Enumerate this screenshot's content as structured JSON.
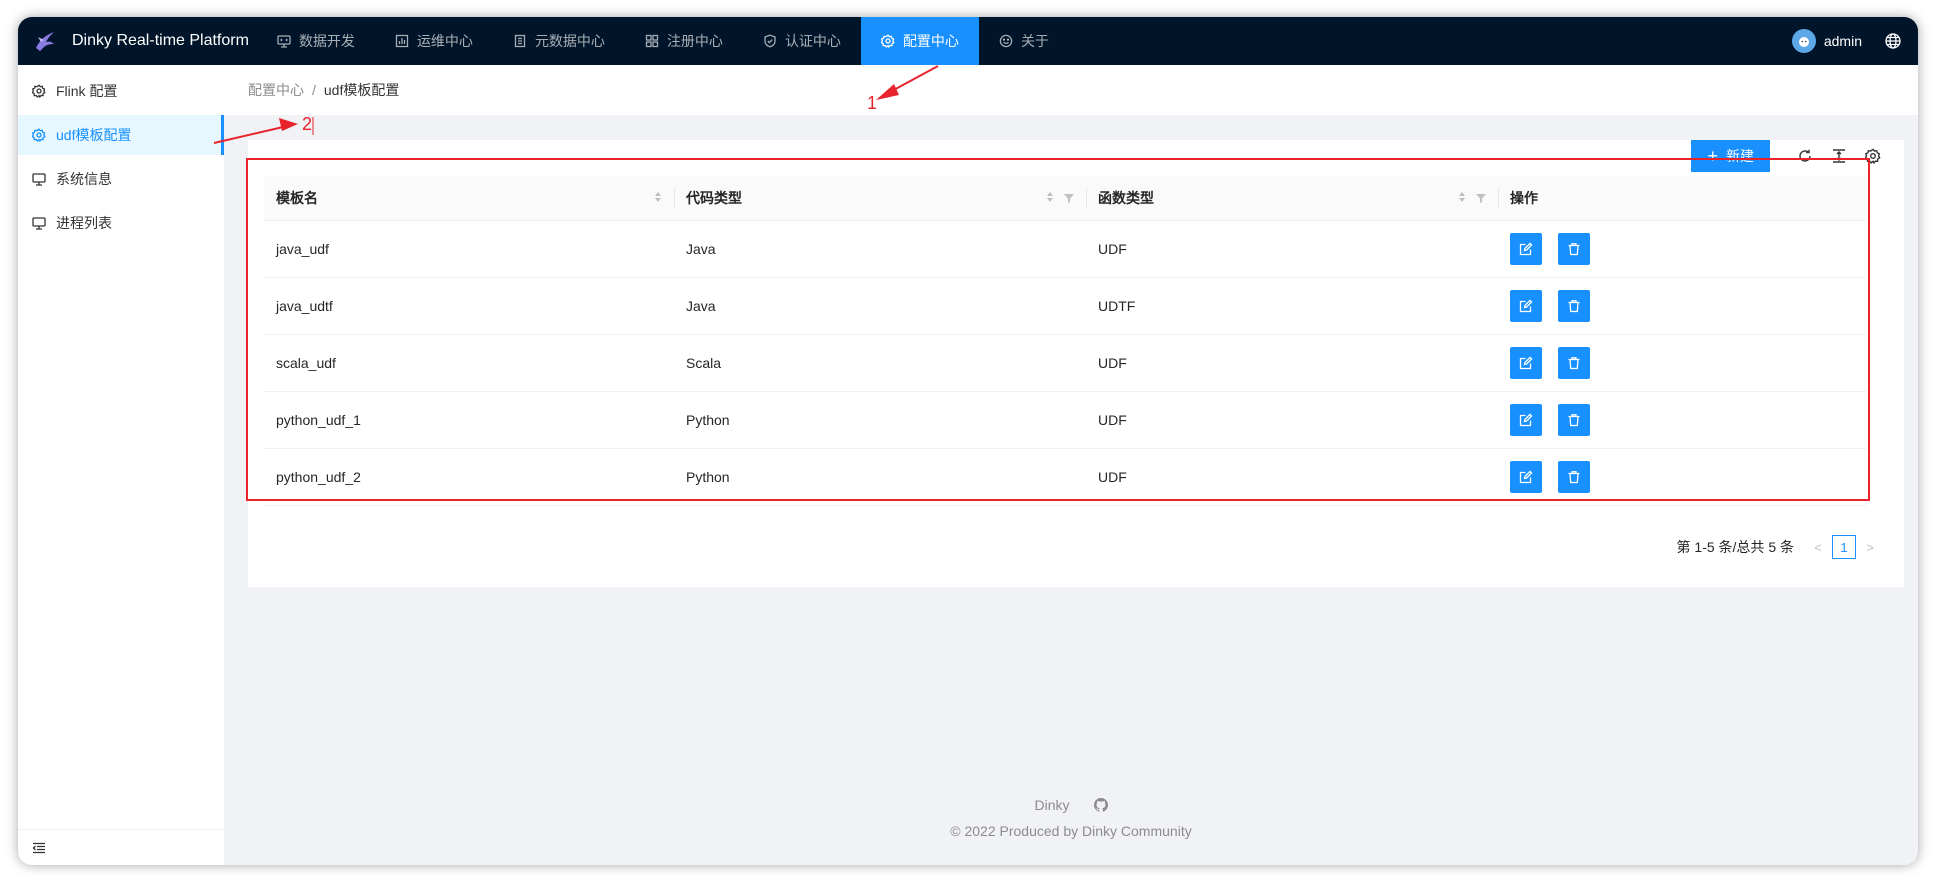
{
  "app": {
    "title": "Dinky Real-time Platform"
  },
  "nav": [
    {
      "label": "数据开发",
      "icon": "monitor-code-icon"
    },
    {
      "label": "运维中心",
      "icon": "dashboard-icon"
    },
    {
      "label": "元数据中心",
      "icon": "database-list-icon"
    },
    {
      "label": "注册中心",
      "icon": "grid-icon"
    },
    {
      "label": "认证中心",
      "icon": "shield-check-icon"
    },
    {
      "label": "配置中心",
      "icon": "gear-icon",
      "active": true
    },
    {
      "label": "关于",
      "icon": "smile-icon"
    }
  ],
  "user": {
    "name": "admin"
  },
  "sidebar": {
    "items": [
      {
        "label": "Flink 配置",
        "icon": "gear-icon"
      },
      {
        "label": "udf模板配置",
        "icon": "gear-icon",
        "active": true
      },
      {
        "label": "系统信息",
        "icon": "desktop-icon"
      },
      {
        "label": "进程列表",
        "icon": "desktop-icon"
      }
    ]
  },
  "breadcrumb": {
    "parent": "配置中心",
    "separator": "/",
    "current": "udf模板配置"
  },
  "toolbar": {
    "new_label": "新建"
  },
  "table": {
    "columns": [
      "模板名",
      "代码类型",
      "函数类型",
      "操作"
    ],
    "rows": [
      {
        "name": "java_udf",
        "code_type": "Java",
        "func_type": "UDF"
      },
      {
        "name": "java_udtf",
        "code_type": "Java",
        "func_type": "UDTF"
      },
      {
        "name": "scala_udf",
        "code_type": "Scala",
        "func_type": "UDF"
      },
      {
        "name": "python_udf_1",
        "code_type": "Python",
        "func_type": "UDF"
      },
      {
        "name": "python_udf_2",
        "code_type": "Python",
        "func_type": "UDF"
      }
    ]
  },
  "pagination": {
    "total_text": "第 1-5 条/总共 5 条",
    "current_page": "1",
    "prev": "<",
    "next": ">"
  },
  "footer": {
    "link": "Dinky",
    "copyright": "2022 Produced by Dinky Community"
  },
  "annotations": {
    "one": "1",
    "two": "2"
  },
  "colors": {
    "primary": "#1890ff",
    "header_bg": "#001529",
    "annotation": "#e8232c"
  }
}
